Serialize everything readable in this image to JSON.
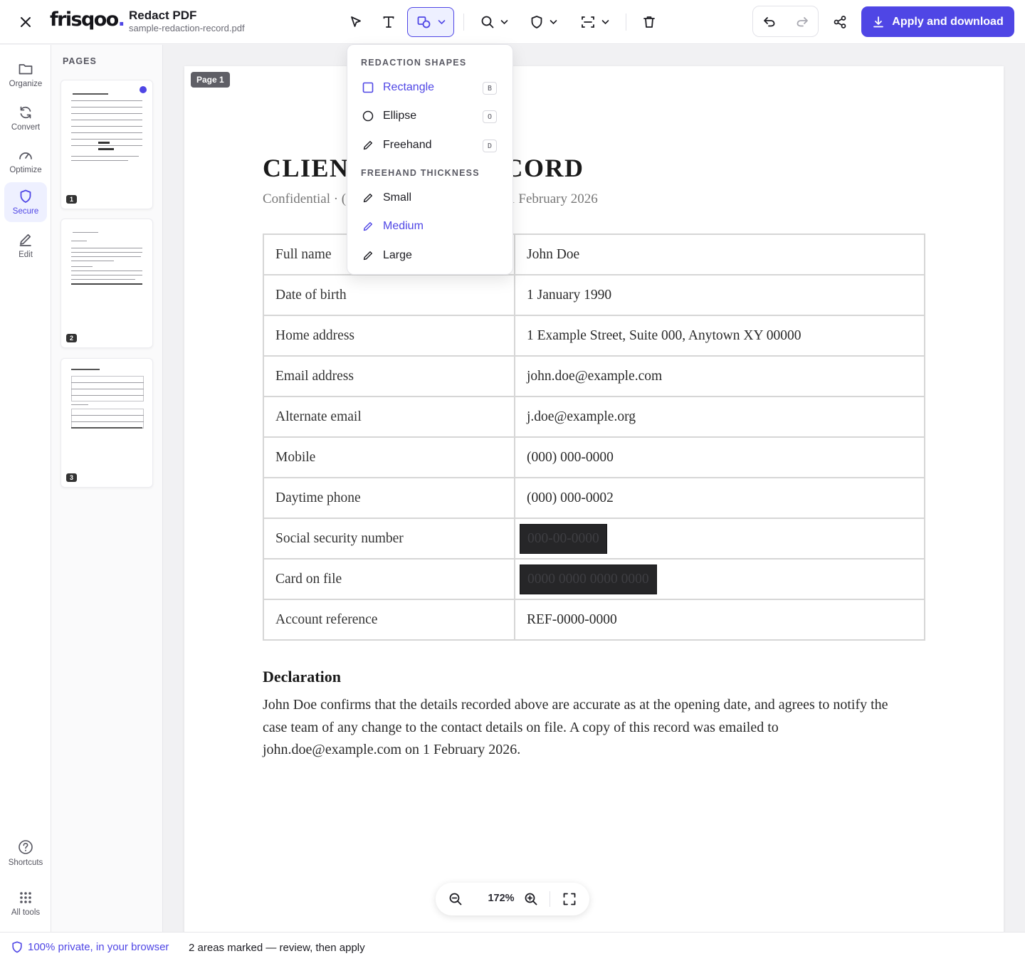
{
  "header": {
    "logo_text": "frisqoo",
    "logo_dot": ".",
    "title": "Redact PDF",
    "filename": "sample-redaction-record.pdf",
    "apply_label": "Apply and download"
  },
  "rail": {
    "items": [
      {
        "label": "Organize",
        "icon": "folder-icon"
      },
      {
        "label": "Convert",
        "icon": "refresh-icon"
      },
      {
        "label": "Optimize",
        "icon": "gauge-icon"
      },
      {
        "label": "Secure",
        "icon": "shield-icon",
        "active": true
      },
      {
        "label": "Edit",
        "icon": "pencil-icon"
      }
    ],
    "bottom": [
      {
        "label": "Shortcuts",
        "icon": "help-circle-icon"
      },
      {
        "label": "All tools",
        "icon": "grid-icon"
      }
    ]
  },
  "pages_panel": {
    "heading": "PAGES",
    "pages": [
      "1",
      "2",
      "3"
    ],
    "active_page": "1"
  },
  "dropdown": {
    "shapes_heading": "REDACTION SHAPES",
    "shapes": [
      {
        "label": "Rectangle",
        "key": "B",
        "selected": true
      },
      {
        "label": "Ellipse",
        "key": "O"
      },
      {
        "label": "Freehand",
        "key": "D"
      }
    ],
    "thickness_heading": "FREEHAND THICKNESS",
    "thickness": [
      {
        "label": "Small"
      },
      {
        "label": "Medium",
        "selected": true
      },
      {
        "label": "Large"
      }
    ]
  },
  "document": {
    "page_label": "Page 1",
    "heading_left": "CLIEN",
    "heading_right": "CORD",
    "sub_left": "Confidential  ·  (",
    "sub_right": "l 1 February 2026",
    "rows": [
      {
        "key": "Full name",
        "value": "John Doe"
      },
      {
        "key": "Date of birth",
        "value": "1 January 1990"
      },
      {
        "key": "Home address",
        "value": "1 Example Street, Suite 000, Anytown XY 00000"
      },
      {
        "key": "Email address",
        "value": "john.doe@example.com"
      },
      {
        "key": "Alternate email",
        "value": "j.doe@example.org"
      },
      {
        "key": "Mobile",
        "value": "(000) 000-0000"
      },
      {
        "key": "Daytime phone",
        "value": "(000) 000-0002"
      },
      {
        "key": "Social security number",
        "value": "000-00-0000",
        "redacted": true
      },
      {
        "key": "Card on file",
        "value": "0000 0000 0000 0000",
        "redacted": true
      },
      {
        "key": "Account reference",
        "value": "REF-0000-0000"
      }
    ],
    "declaration_heading": "Declaration",
    "declaration_text": "John Doe confirms that the details recorded above are accurate as at the opening date, and agrees to notify the case team of any change to the contact details on file. A copy of this record was emailed to john.doe@example.com on 1 February 2026."
  },
  "zoom": {
    "level": "172%"
  },
  "status": {
    "private": "100% private, in your browser",
    "message": "2 areas marked — review, then apply"
  },
  "colors": {
    "accent": "#4f46e5",
    "redaction": "#262628"
  }
}
